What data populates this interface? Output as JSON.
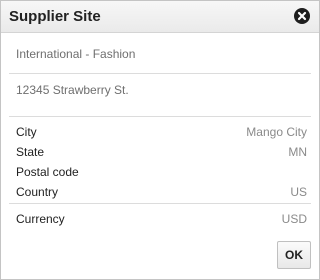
{
  "dialog": {
    "title": "Supplier Site",
    "close_icon": "close-circle-icon"
  },
  "site": {
    "name": "International - Fashion",
    "address": "12345 Strawberry St."
  },
  "fields": [
    {
      "label": "City",
      "value": "Mango City"
    },
    {
      "label": "State",
      "value": "MN"
    },
    {
      "label": "Postal code",
      "value": ""
    },
    {
      "label": "Country",
      "value": "US"
    }
  ],
  "currency": {
    "label": "Currency",
    "value": "USD"
  },
  "ok_label": "OK"
}
